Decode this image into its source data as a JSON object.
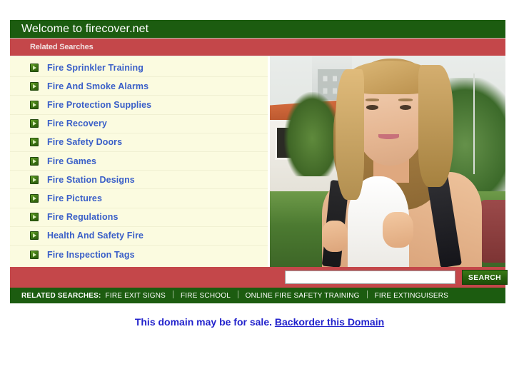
{
  "header": {
    "title": "Welcome to firecover.net"
  },
  "related_searches_bar": {
    "label": "Related Searches"
  },
  "links": [
    {
      "label": "Fire Sprinkler Training"
    },
    {
      "label": "Fire And Smoke Alarms"
    },
    {
      "label": "Fire Protection Supplies"
    },
    {
      "label": "Fire Recovery"
    },
    {
      "label": "Fire Safety Doors"
    },
    {
      "label": "Fire Games"
    },
    {
      "label": "Fire Station Designs"
    },
    {
      "label": "Fire Pictures"
    },
    {
      "label": "Fire Regulations"
    },
    {
      "label": "Health And Safety Fire"
    },
    {
      "label": "Fire Inspection Tags"
    }
  ],
  "search": {
    "value": "",
    "placeholder": "",
    "button_label": "SEARCH"
  },
  "footer_bar": {
    "label": "RELATED SEARCHES:",
    "items": [
      "FIRE EXIT SIGNS",
      "FIRE SCHOOL",
      "ONLINE FIRE SAFETY TRAINING",
      "FIRE EXTINGUISERS"
    ]
  },
  "sale_notice": {
    "text": "This domain may be for sale.",
    "link_label": "Backorder this Domain"
  },
  "icons": {
    "bullet": "arrow-right-icon"
  },
  "colors": {
    "green": "#1c5c10",
    "red": "#c4474a",
    "cream": "#fbfbe0",
    "link_blue": "#3a5fc8",
    "sale_blue": "#2222cc"
  }
}
